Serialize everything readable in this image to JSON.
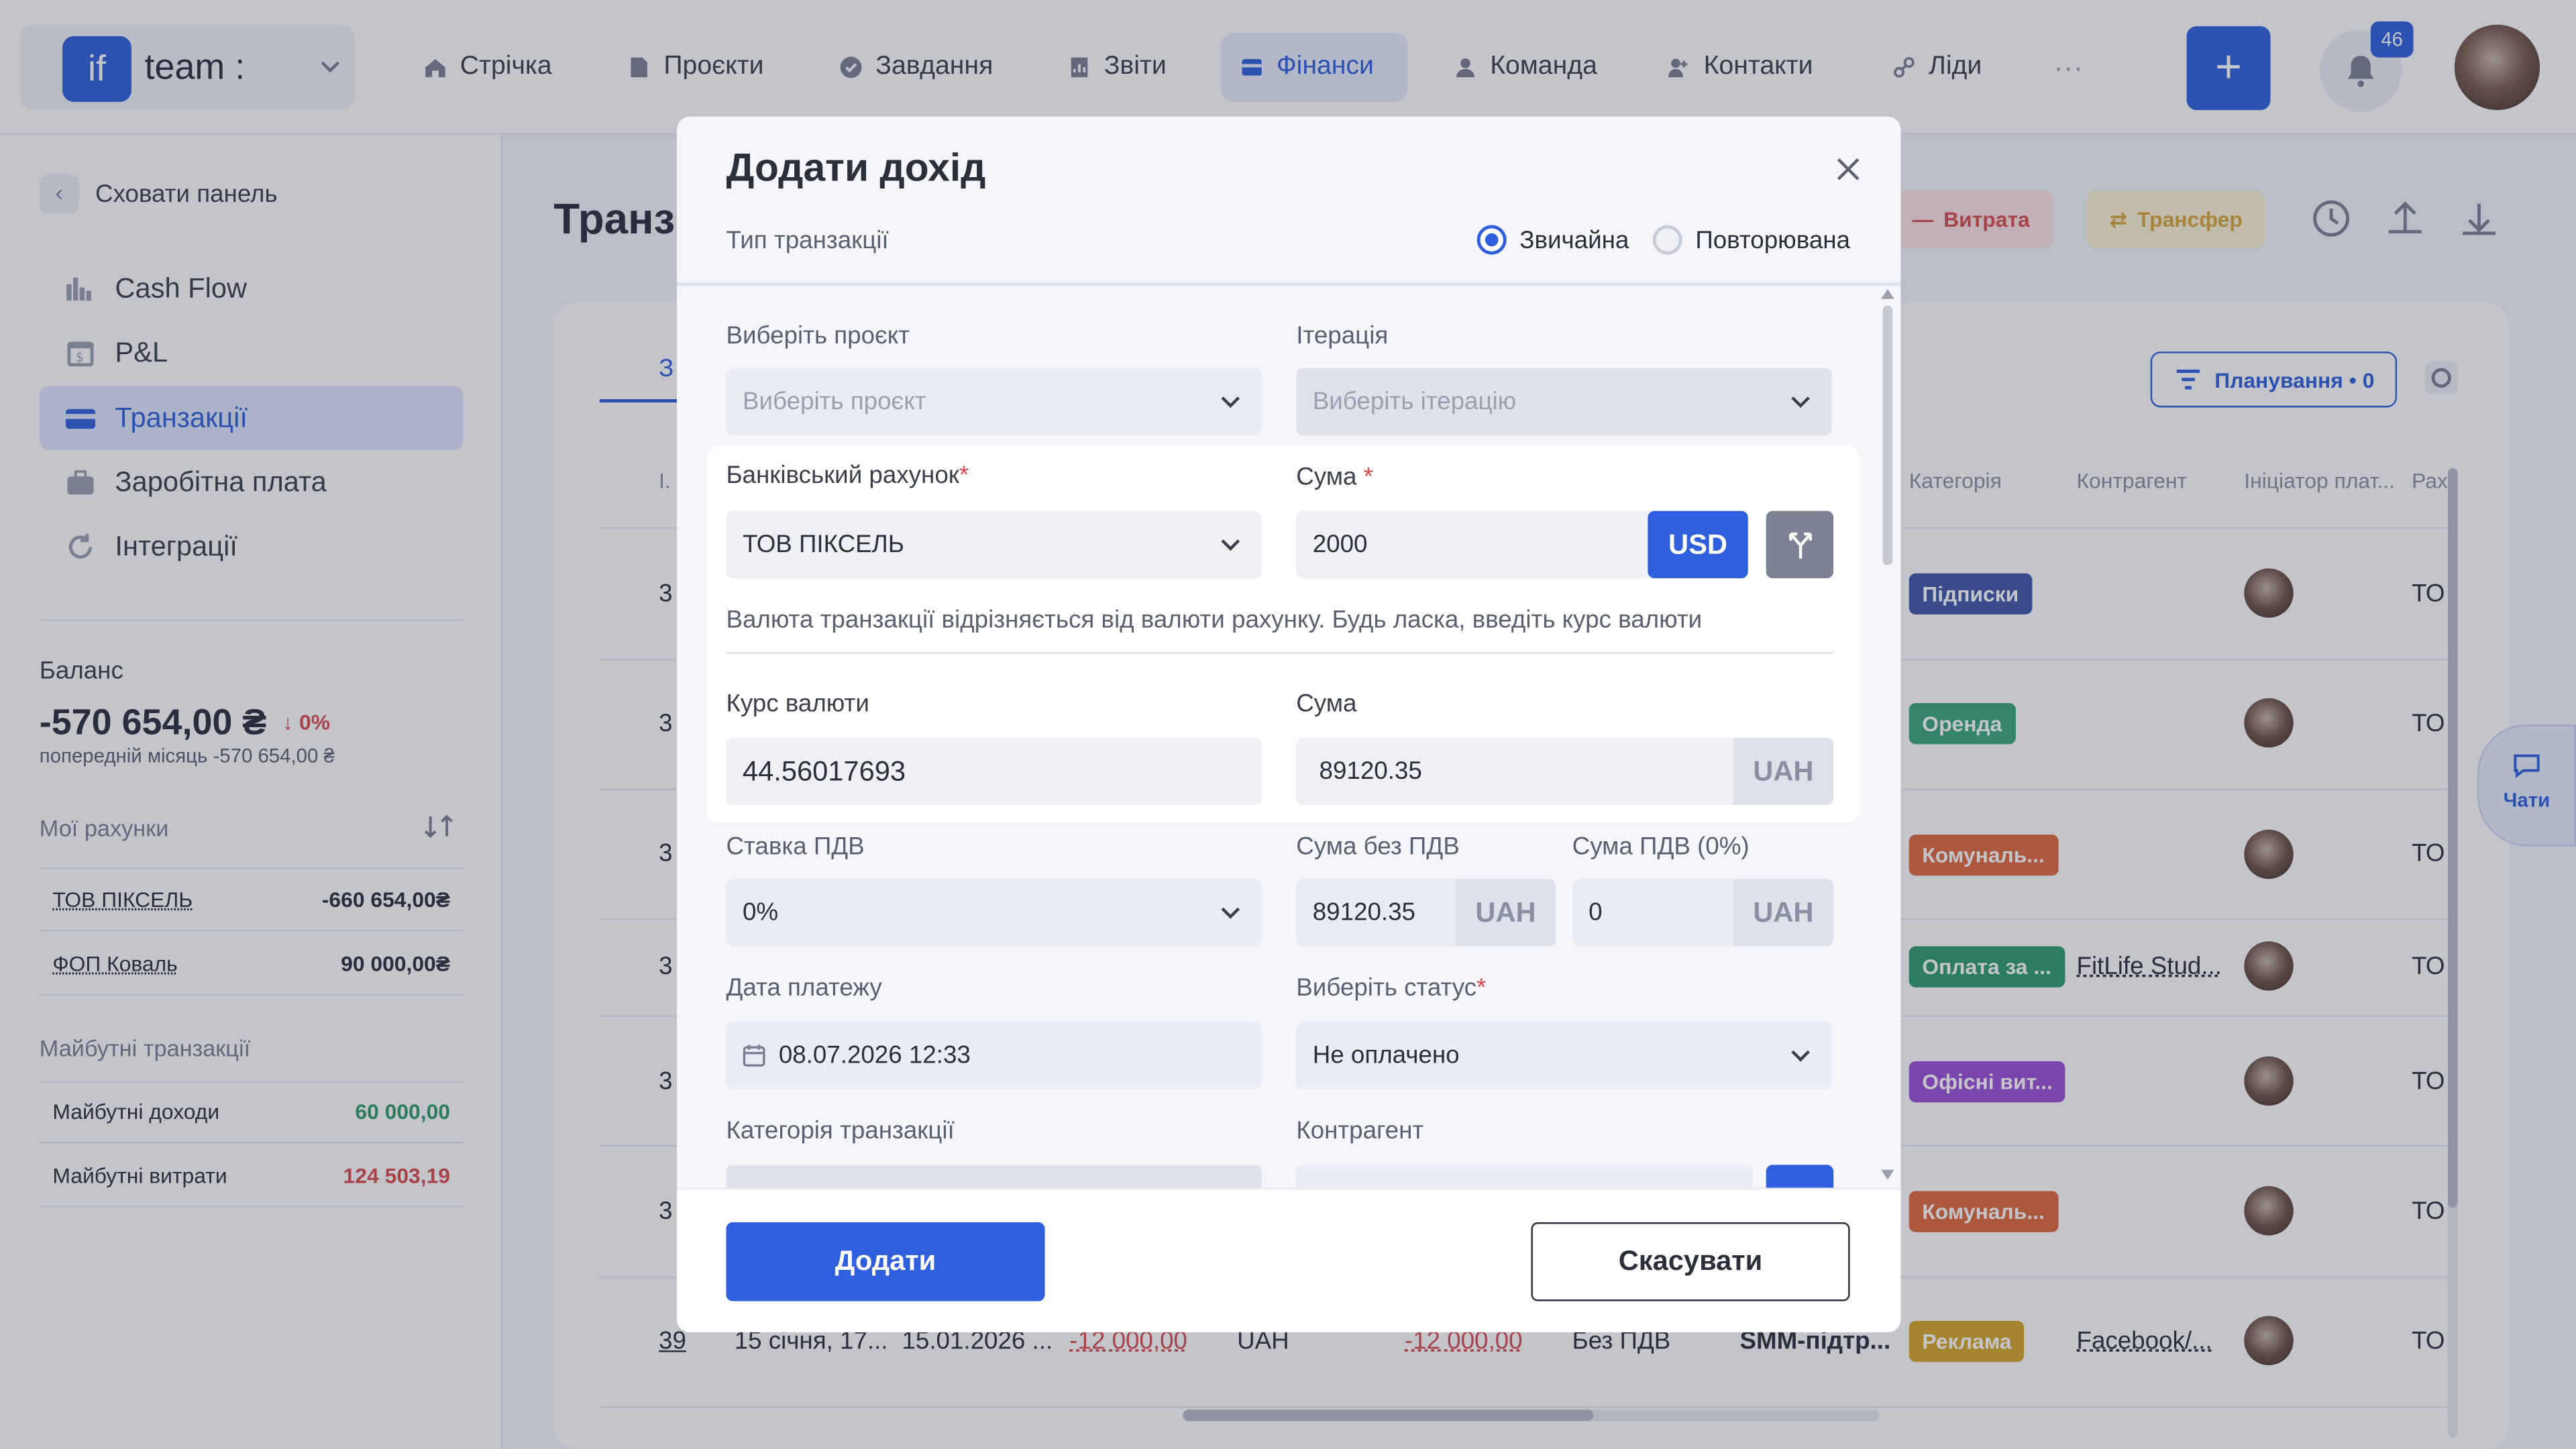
{
  "header": {
    "logo_text": "if",
    "team_name": "team :",
    "nav": [
      {
        "label": "Стрічка",
        "icon": "home-icon"
      },
      {
        "label": "Проєкти",
        "icon": "document-icon"
      },
      {
        "label": "Завдання",
        "icon": "check-circle-icon"
      },
      {
        "label": "Звіти",
        "icon": "report-icon"
      },
      {
        "label": "Фінанси",
        "icon": "wallet-icon",
        "active": true
      },
      {
        "label": "Команда",
        "icon": "user-icon"
      },
      {
        "label": "Контакти",
        "icon": "contacts-icon"
      },
      {
        "label": "Ліди",
        "icon": "leads-icon"
      }
    ],
    "more": "···",
    "add_label": "+",
    "notifications_count": "46"
  },
  "sidebar": {
    "hide_panel": "Сховати панель",
    "items": [
      {
        "label": "Cash Flow"
      },
      {
        "label": "P&L"
      },
      {
        "label": "Транзакції",
        "active": true
      },
      {
        "label": "Заробітна плата"
      },
      {
        "label": "Інтеграції"
      }
    ],
    "balance_label": "Баланс",
    "balance_value": "-570 654,00 ₴",
    "balance_change": "↓ 0%",
    "balance_prev": "попередній місяць -570 654,00 ₴",
    "accounts_title": "Мої рахунки",
    "accounts": [
      {
        "name": "ТОВ ПІКСЕЛЬ",
        "value": "-660 654,00₴"
      },
      {
        "name": "ФОП Коваль",
        "value": "90 000,00₴"
      }
    ],
    "future_title": "Майбутні транзакції",
    "future": [
      {
        "name": "Майбутні доходи",
        "value": "60 000,00"
      },
      {
        "name": "Майбутні витрати",
        "value": "124 503,19"
      }
    ]
  },
  "main": {
    "title": "Транз",
    "expense_btn": "Витрата",
    "transfer_btn": "Трансфер",
    "planning_btn": "Планування • 0",
    "tab_partial": "З",
    "id_header_partial": "І.",
    "columns": [
      "Категорія",
      "Контрагент",
      "Ініціатор плат...",
      "Рах"
    ],
    "row_ids": [
      "3",
      "3",
      "3",
      "3",
      "3",
      "3"
    ],
    "row_account_partial": "ТО",
    "tags": [
      {
        "label": "Підписки",
        "color": "#3f55a8"
      },
      {
        "label": "Оренда",
        "color": "#3aa57a"
      },
      {
        "label": "Комуналь...",
        "color": "#e0693c"
      },
      {
        "label": "Оплата за ...",
        "color": "#2f9a6a"
      },
      {
        "label": "Офісні вит...",
        "color": "#9a4fd6"
      },
      {
        "label": "Комуналь...",
        "color": "#e0693c"
      },
      {
        "label": "Реклама",
        "color": "#d7a72a"
      }
    ],
    "counterparty_row4": "FitLife Stud...",
    "last_row": {
      "id": "39",
      "date": "15 січня, 17...",
      "pay_date": "15.01.2026 ...",
      "amount": "-12 000,00",
      "currency": "UAH",
      "amount2": "-12 000,00",
      "vat": "Без ПДВ",
      "project": "SMM-підтр...",
      "tag": "Реклама",
      "counterparty": "Facebook/...",
      "account": "ТО"
    },
    "chats_label": "Чати"
  },
  "modal": {
    "title": "Додати дохід",
    "type_label": "Тип транзакції",
    "type_regular": "Звичайна",
    "type_recurring": "Повторювана",
    "project_label": "Виберіть проєкт",
    "project_placeholder": "Виберіть проєкт",
    "iteration_label": "Ітерація",
    "iteration_placeholder": "Виберіть ітерацію",
    "bank_label": "Банківський рахунок",
    "bank_value": "ТОВ ПІКСЕЛЬ",
    "amount_label": "Сума",
    "amount_value": "2000",
    "currency": "USD",
    "hint": "Валюта транзакції відрізняється від валюти рахунку. Будь ласка, введіть курс валюти",
    "rate_label": "Курс валюти",
    "rate_value": "44.56017693",
    "converted_label": "Сума",
    "converted_value": "89120.35",
    "uah": "UAH",
    "vat_rate_label": "Ставка ПДВ",
    "vat_rate_value": "0%",
    "sum_no_vat_label": "Сума без ПДВ",
    "sum_no_vat_value": "89120.35",
    "vat_sum_label": "Сума ПДВ (0%)",
    "vat_sum_value": "0",
    "date_label": "Дата платежу",
    "date_value": "08.07.2026 12:33",
    "status_label": "Виберіть статус",
    "status_value": "Не оплачено",
    "category_label": "Категорія транзакції",
    "counterparty_label": "Контрагент",
    "required_mark": "*",
    "submit": "Додати",
    "cancel": "Скасувати"
  }
}
